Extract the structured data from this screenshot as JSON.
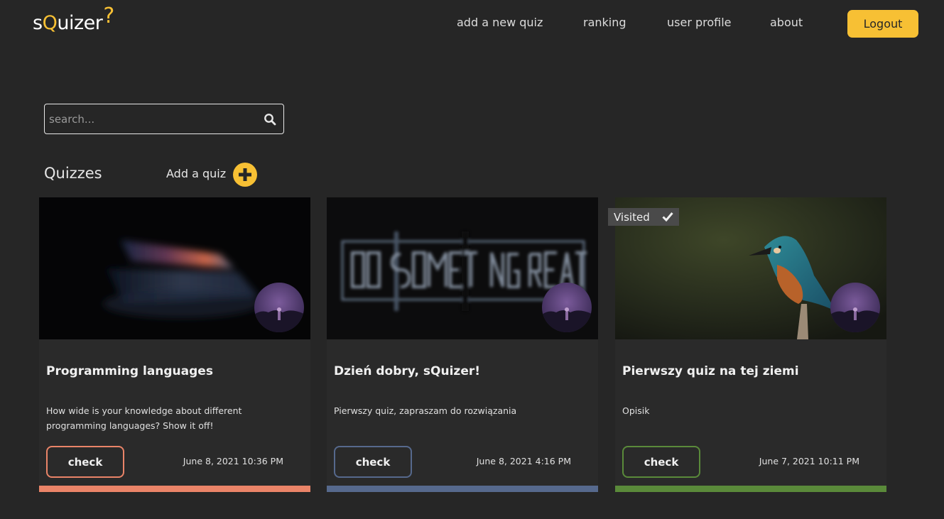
{
  "logo": {
    "s": "s",
    "q": "Q",
    "rest": "uizer",
    "mark": "?"
  },
  "nav": {
    "add_quiz": "add a new quiz",
    "ranking": "ranking",
    "user_profile": "user profile",
    "about": "about",
    "logout": "Logout"
  },
  "search": {
    "placeholder": "search..."
  },
  "section": {
    "title": "Quizzes",
    "add_label": "Add a quiz"
  },
  "colors": {
    "accent": "#f7c034",
    "background": "#262626"
  },
  "cards": [
    {
      "title": "Programming languages",
      "description": "How wide is your knowledge about different programming languages? Show it off!",
      "button": "check",
      "date": "June 8, 2021 10:36 PM",
      "color": "#ea8468",
      "visited": false
    },
    {
      "title": "Dzień dobry, sQuizer!",
      "description": "Pierwszy quiz, zapraszam do rozwiązania",
      "button": "check",
      "date": "June 8, 2021 4:16 PM",
      "color": "#56698d",
      "visited": false
    },
    {
      "title": "Pierwszy quiz na tej ziemi",
      "description": "Opisik",
      "button": "check",
      "date": "June 7, 2021 10:11 PM",
      "color": "#5a8a3a",
      "visited": true,
      "visited_label": "Visited"
    }
  ]
}
